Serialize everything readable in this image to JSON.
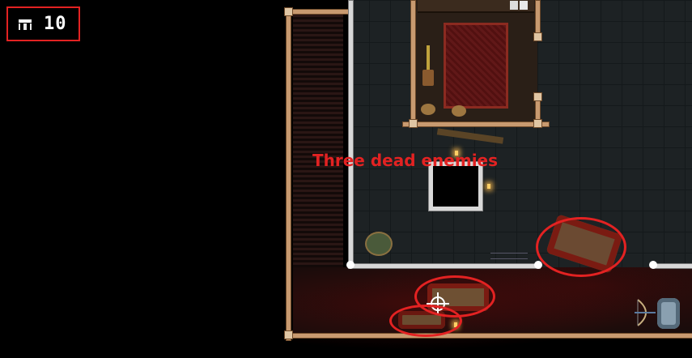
{
  "hud": {
    "counter_value": "10",
    "counter_icon": "chest-icon"
  },
  "annotation": {
    "text": "Three dead enemies",
    "color": "#e32222"
  },
  "highlights": [
    {
      "name": "dead-enemy-1"
    },
    {
      "name": "dead-enemy-2"
    },
    {
      "name": "dead-enemy-3"
    }
  ],
  "colors": {
    "annotation_red": "#e32222",
    "floor": "#1d2224",
    "rug": "#5a1414"
  }
}
